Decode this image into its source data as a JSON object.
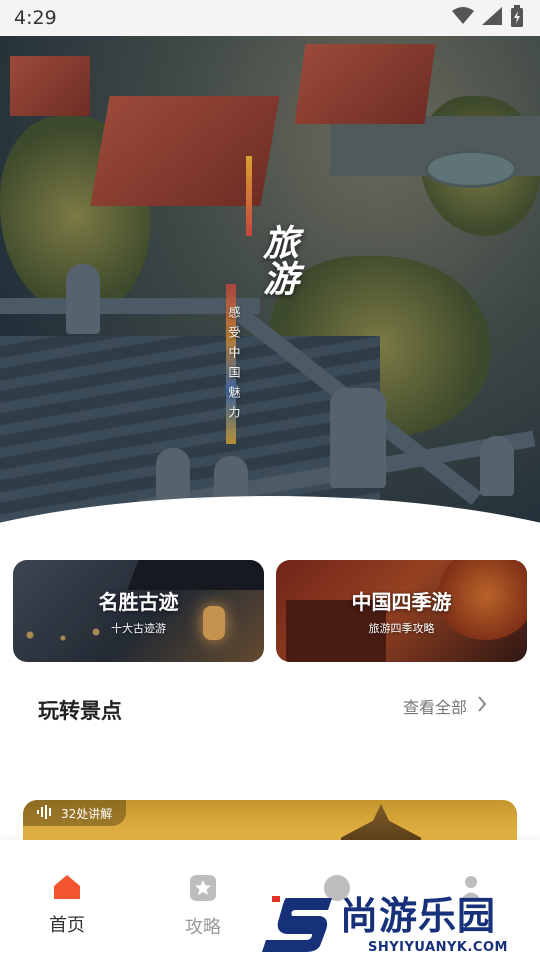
{
  "status_bar": {
    "time": "4:29",
    "icons": [
      "wifi-icon",
      "cell-signal-icon",
      "battery-charging-icon"
    ]
  },
  "hero": {
    "title": "旅游",
    "subtitle": "感受中国魅力"
  },
  "categories": [
    {
      "title": "名胜古迹",
      "subtitle": "十大古迹游"
    },
    {
      "title": "中国四季游",
      "subtitle": "旅游四季攻略"
    }
  ],
  "section": {
    "title": "玩转景点",
    "view_all": "查看全部"
  },
  "scenic_card": {
    "audio_badge": "32处讲解"
  },
  "bottom_nav": [
    {
      "label": "首页",
      "icon": "home-icon",
      "active": true
    },
    {
      "label": "攻略",
      "icon": "star-icon",
      "active": false
    },
    {
      "label": "",
      "icon": "compass-icon",
      "active": false
    },
    {
      "label": "",
      "icon": "profile-icon",
      "active": false
    }
  ],
  "watermark": {
    "text": "尚游乐园",
    "url": "SHYIYUANYK.COM"
  },
  "colors": {
    "accent": "#f2542d",
    "nav_inactive": "#9a9a9a",
    "watermark_blue": "#17307a"
  }
}
